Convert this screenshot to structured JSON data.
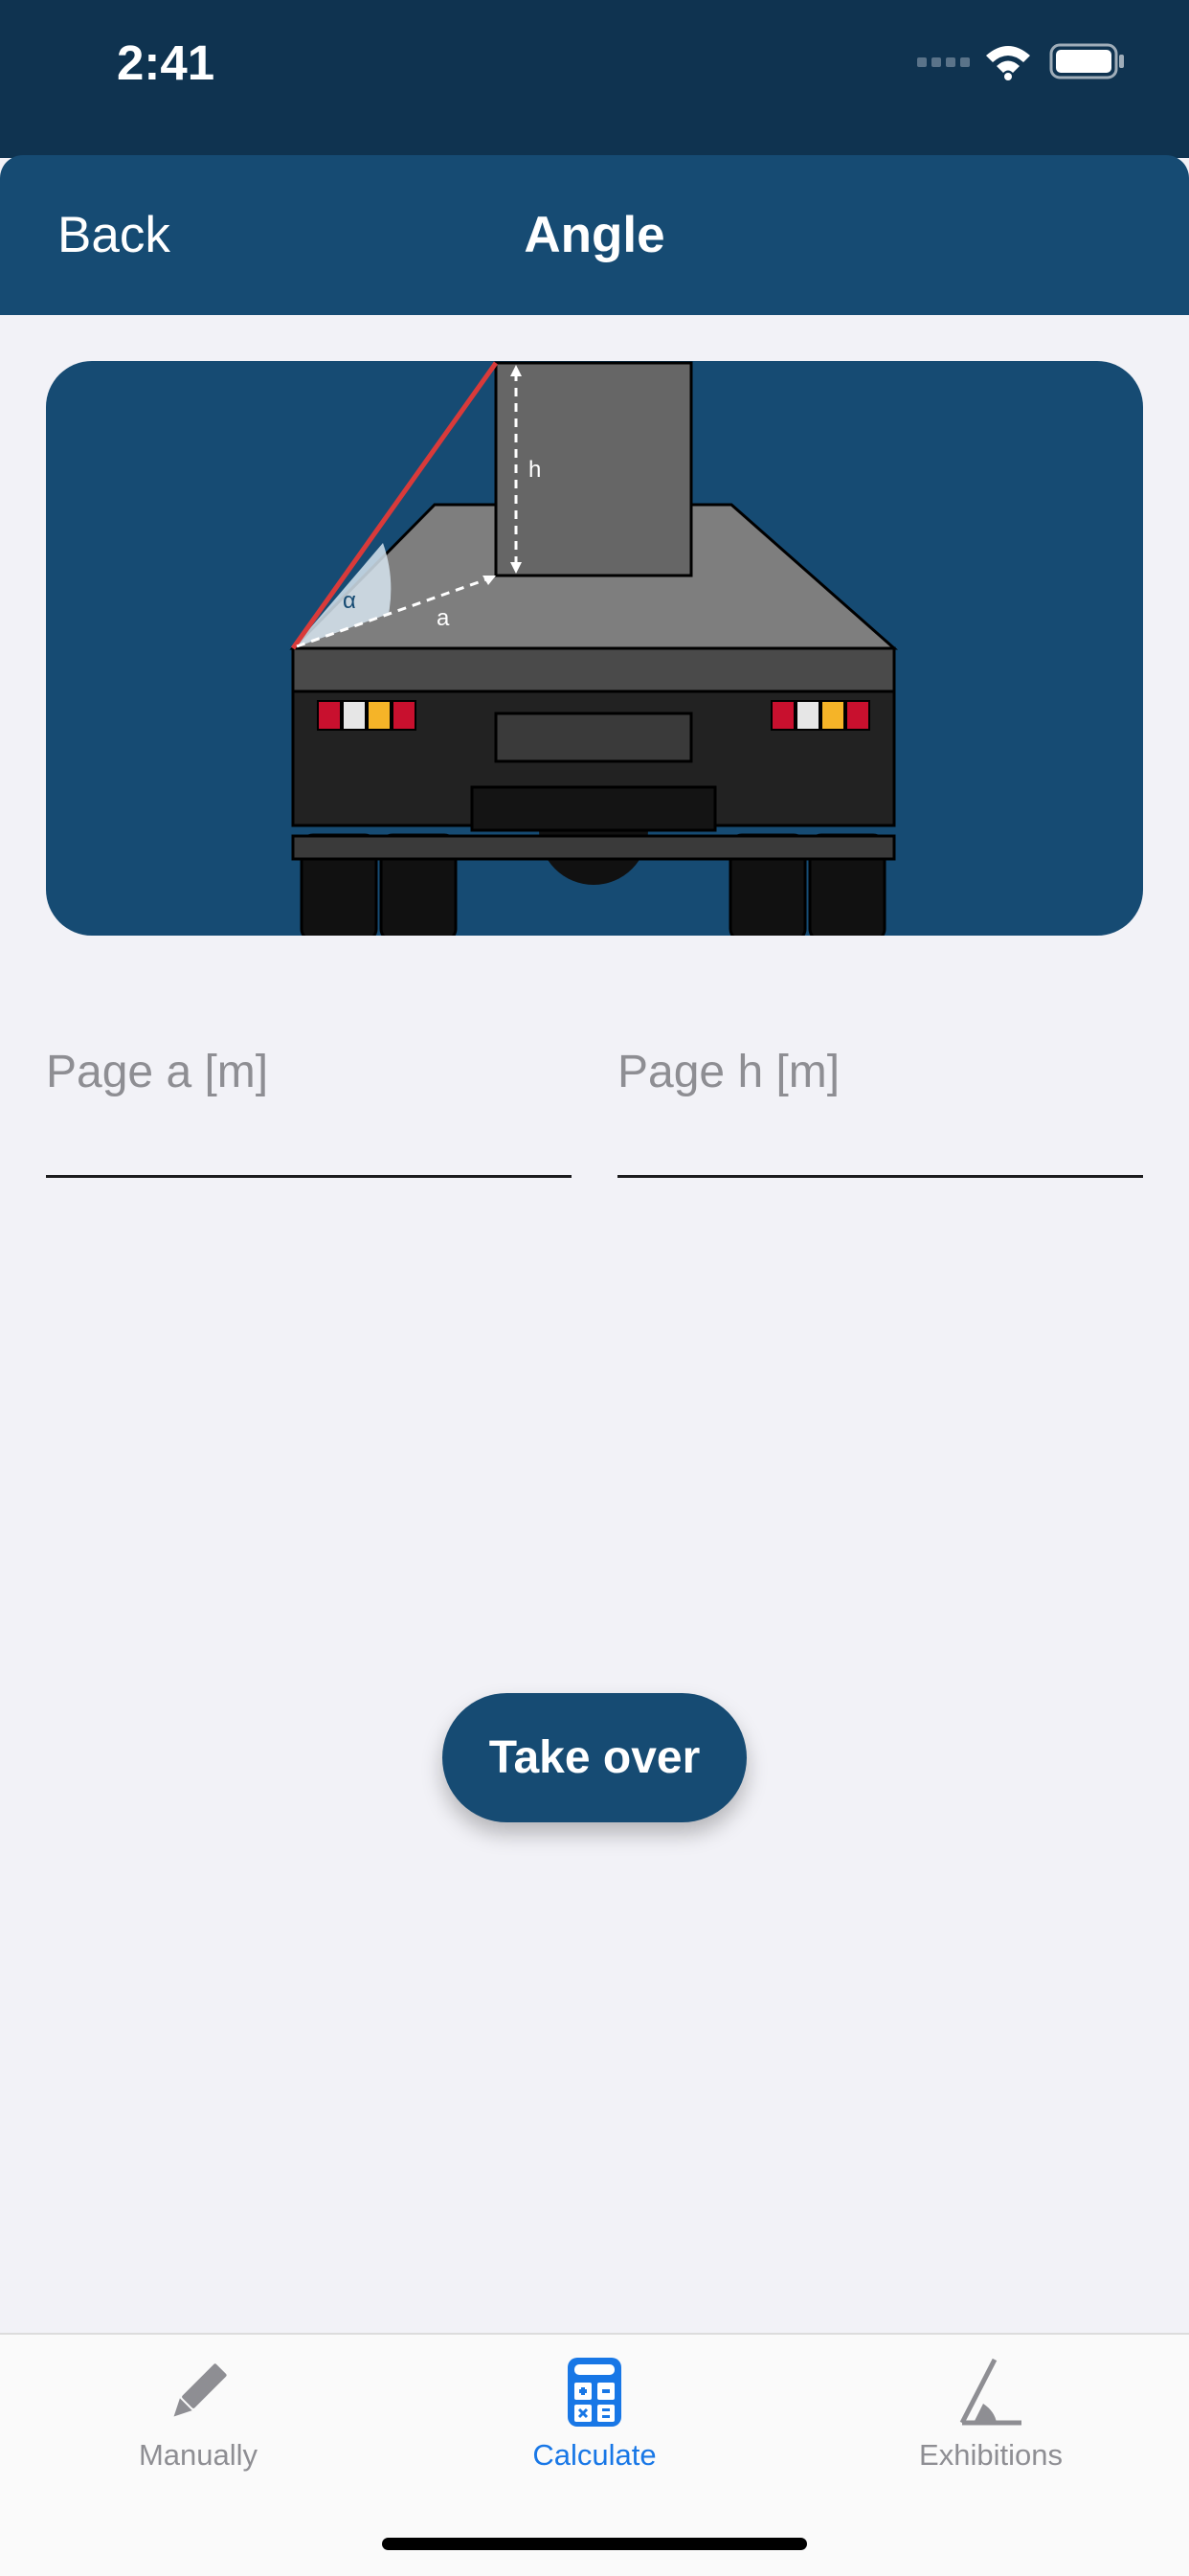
{
  "status_bar": {
    "time": "2:41"
  },
  "nav": {
    "back_label": "Back",
    "title": "Angle"
  },
  "illustration": {
    "label_alpha": "α",
    "label_a": "a",
    "label_h": "h"
  },
  "form": {
    "field_a_placeholder": "Page a [m]",
    "field_h_placeholder": "Page h [m]",
    "field_a_value": "",
    "field_h_value": ""
  },
  "take_over_label": "Take over",
  "tabs": [
    {
      "label": "Manually",
      "icon": "pencil-icon",
      "active": false
    },
    {
      "label": "Calculate",
      "icon": "calculator-icon",
      "active": true
    },
    {
      "label": "Exhibitions",
      "icon": "angle-icon",
      "active": false
    }
  ],
  "colors": {
    "status_bar": "#0f3350",
    "accent": "#164b73",
    "active_tab": "#1877e6",
    "background": "#f2f2f7"
  }
}
